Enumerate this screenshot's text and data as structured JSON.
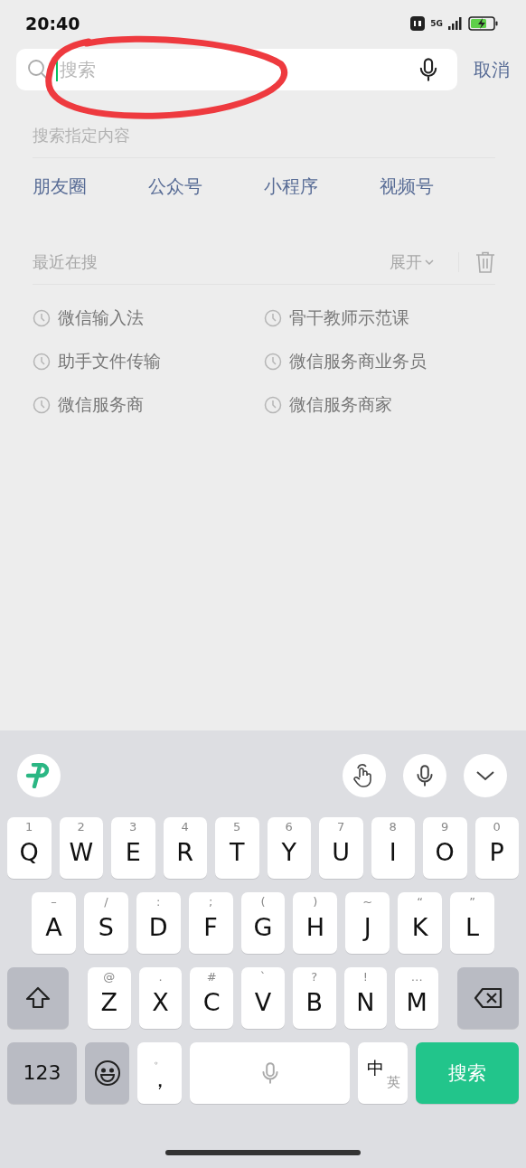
{
  "status_bar": {
    "time": "20:40",
    "network": "5G"
  },
  "search": {
    "placeholder": "搜索",
    "cancel": "取消"
  },
  "specific": {
    "title": "搜索指定内容",
    "categories": [
      "朋友圈",
      "公众号",
      "小程序",
      "视频号"
    ]
  },
  "recent": {
    "title": "最近在搜",
    "expand": "展开",
    "items": [
      "微信输入法",
      "骨干教师示范课",
      "助手文件传输",
      "微信服务商业务员",
      "微信服务商",
      "微信服务商家"
    ]
  },
  "keyboard": {
    "rows": [
      [
        {
          "kind": "letter",
          "label": "Q",
          "hint": "1"
        },
        {
          "kind": "letter",
          "label": "W",
          "hint": "2"
        },
        {
          "kind": "letter",
          "label": "E",
          "hint": "3"
        },
        {
          "kind": "letter",
          "label": "R",
          "hint": "4"
        },
        {
          "kind": "letter",
          "label": "T",
          "hint": "5"
        },
        {
          "kind": "letter",
          "label": "Y",
          "hint": "6"
        },
        {
          "kind": "letter",
          "label": "U",
          "hint": "7"
        },
        {
          "kind": "letter",
          "label": "I",
          "hint": "8"
        },
        {
          "kind": "letter",
          "label": "O",
          "hint": "9"
        },
        {
          "kind": "letter",
          "label": "P",
          "hint": "0"
        }
      ],
      [
        {
          "kind": "letter",
          "label": "A",
          "hint": "–"
        },
        {
          "kind": "letter",
          "label": "S",
          "hint": "/"
        },
        {
          "kind": "letter",
          "label": "D",
          "hint": ":"
        },
        {
          "kind": "letter",
          "label": "F",
          "hint": ";"
        },
        {
          "kind": "letter",
          "label": "G",
          "hint": "("
        },
        {
          "kind": "letter",
          "label": "H",
          "hint": ")"
        },
        {
          "kind": "letter",
          "label": "J",
          "hint": "~"
        },
        {
          "kind": "letter",
          "label": "K",
          "hint": "“"
        },
        {
          "kind": "letter",
          "label": "L",
          "hint": "”"
        }
      ],
      [
        {
          "kind": "shift"
        },
        {
          "kind": "letter",
          "label": "Z",
          "hint": "@"
        },
        {
          "kind": "letter",
          "label": "X",
          "hint": "."
        },
        {
          "kind": "letter",
          "label": "C",
          "hint": "#"
        },
        {
          "kind": "letter",
          "label": "V",
          "hint": "`"
        },
        {
          "kind": "letter",
          "label": "B",
          "hint": "?"
        },
        {
          "kind": "letter",
          "label": "N",
          "hint": "!"
        },
        {
          "kind": "letter",
          "label": "M",
          "hint": "…"
        },
        {
          "kind": "backspace"
        }
      ],
      [
        {
          "kind": "numbers",
          "label": "123"
        },
        {
          "kind": "emoji"
        },
        {
          "kind": "punct",
          "label": "，",
          "hint": "。"
        },
        {
          "kind": "space"
        },
        {
          "kind": "lang",
          "label": "中",
          "hint": "英"
        },
        {
          "kind": "action",
          "label": "搜索"
        }
      ]
    ]
  }
}
